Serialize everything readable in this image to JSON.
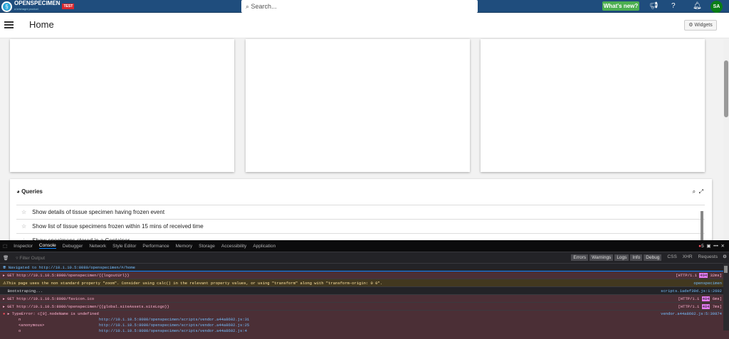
{
  "header": {
    "brand": "OPENSPECIMEN",
    "brand_sub": "a krishagni product",
    "env_badge": "TEST",
    "search_placeholder": "Search...",
    "whats_new": "What's new?",
    "avatar_initials": "SA",
    "colors": {
      "header": "#1f4d7d",
      "whats_new": "#4caf50",
      "avatar": "#0a7d17"
    }
  },
  "page": {
    "title": "Home",
    "widgets_button": "Widgets"
  },
  "queries": {
    "title": "Queries",
    "items": [
      "Show details of tissue specimen having frozen event",
      "Show list of tissue specimens frozen within 15 mins of received time",
      "Show specimens stored in a Container"
    ]
  },
  "devtools": {
    "tabs": [
      "Inspector",
      "Console",
      "Debugger",
      "Network",
      "Style Editor",
      "Performance",
      "Memory",
      "Storage",
      "Accessibility",
      "Application"
    ],
    "active_tab": "Console",
    "error_count": "5",
    "filter_placeholder": "Filter Output",
    "filters": [
      "Errors",
      "Warnings",
      "Logs",
      "Info",
      "Debug"
    ],
    "extra_filters": [
      "CSS",
      "XHR",
      "Requests"
    ],
    "messages": [
      {
        "type": "nav",
        "text": "Navigated to http://10.1.10.5:8080/openspecimen/#/home"
      },
      {
        "type": "err",
        "text": "GET http://10.1.10.5:8080/openspecimen/{{logoutUrl}}",
        "proto": "[HTTP/1.1",
        "status": "404",
        "time": "32ms]"
      },
      {
        "type": "warn",
        "text": "This page uses the non standard property \"zoom\". Consider using calc() in the relevant property values, or using \"transform\" along with \"transform-origin: 0 0\".",
        "source": "openspecimen"
      },
      {
        "type": "log",
        "text": "Bootstraping...",
        "source": "scripts.1adef39d.js:1:2602"
      },
      {
        "type": "err",
        "text": "GET http://10.1.10.5:8080/favicon.ico",
        "proto": "[HTTP/1.1",
        "status": "404",
        "time": "6ms]"
      },
      {
        "type": "err",
        "text": "GET http://10.1.10.5:8080/openspecimen/{{global.siteAssets.siteLogo}}",
        "proto": "[HTTP/1.1",
        "status": "404",
        "time": "7ms]"
      },
      {
        "type": "err",
        "text": "TypeError: c[0].nodeName is undefined",
        "source": "vendor.a44a8602.js:5:30874"
      }
    ],
    "stack": [
      {
        "fn": "n",
        "loc": "http://10.1.10.5:8080/openspecimen/scripts/vendor.a44a8602.js:31"
      },
      {
        "fn": "<anonymous>",
        "loc": "http://10.1.10.5:8080/openspecimen/scripts/vendor.a44a8602.js:25"
      },
      {
        "fn": "o",
        "loc": "http://10.1.10.5:8080/openspecimen/scripts/vendor.a44a8602.js:4"
      }
    ]
  }
}
